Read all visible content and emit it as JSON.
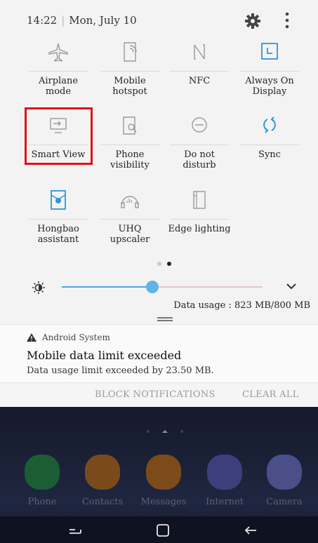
{
  "status": {
    "time": "14:22",
    "date": "Mon, July 10"
  },
  "header_icons": [
    "gear-icon",
    "more-vertical-icon"
  ],
  "tiles": [
    {
      "label": "Airplane\nmode",
      "icon": "airplane-icon",
      "active": false
    },
    {
      "label": "Mobile\nhotspot",
      "icon": "hotspot-icon",
      "active": false
    },
    {
      "label": "NFC",
      "icon": "nfc-icon",
      "active": false
    },
    {
      "label": "Always On\nDisplay",
      "icon": "always-on-display-icon",
      "active": true
    },
    {
      "label": "Smart View",
      "icon": "smart-view-icon",
      "active": false
    },
    {
      "label": "Phone\nvisibility",
      "icon": "phone-visibility-icon",
      "active": false
    },
    {
      "label": "Do not\ndisturb",
      "icon": "do-not-disturb-icon",
      "active": false
    },
    {
      "label": "Sync",
      "icon": "sync-icon",
      "active": true
    },
    {
      "label": "Hongbao\nassistant",
      "icon": "hongbao-icon",
      "active": true
    },
    {
      "label": "UHQ\nupscaler",
      "icon": "uhq-upscaler-icon",
      "active": false
    },
    {
      "label": "Edge lighting",
      "icon": "edge-lighting-icon",
      "active": false
    }
  ],
  "pager": {
    "pages": 2,
    "current": 2
  },
  "brightness": {
    "level": 0.45
  },
  "data_usage": "Data usage : 823 MB/800 MB",
  "notification": {
    "source": "Android System",
    "title": "Mobile data limit exceeded",
    "body": "Data usage limit exceeded by 23.50 MB."
  },
  "actions": {
    "block": "BLOCK NOTIFICATIONS",
    "clear": "CLEAR ALL"
  },
  "dock": [
    {
      "name": "Phone",
      "color": "#1b5e35"
    },
    {
      "name": "Contacts",
      "color": "#7a4a1a"
    },
    {
      "name": "Messages",
      "color": "#7d4a1a"
    },
    {
      "name": "Internet",
      "color": "#3d3f7d"
    },
    {
      "name": "Camera",
      "color": "#4a4f8a"
    }
  ],
  "colors": {
    "accent": "#2f97d8",
    "highlight": "#e0101a"
  }
}
